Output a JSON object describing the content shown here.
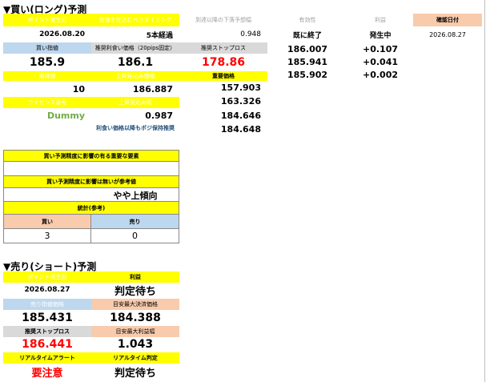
{
  "section1": {
    "title": "▼買い(ロング)予測",
    "hdr": {
      "point_date": "ポイント発生日",
      "timing": "指値を仕込むべきタイミング",
      "deadline": "到達以降の下落予想幅",
      "expiry": "有効性",
      "profit": "利益",
      "decision": "確認日付"
    },
    "row1": {
      "date": "2026.08.20",
      "timing": "5本経過",
      "deadline_val": "0.948",
      "expiry_val": "既に終了",
      "profit_val": "発生中",
      "decision_date": "2026.08.27"
    },
    "hdr2": {
      "buy_limit": "買い指値",
      "recommended": "推奨利食い価格（20pips固定）",
      "stoploss": "推奨ストップロス",
      "important": "重要価格"
    },
    "row2": {
      "buy_limit": "185.9",
      "recommended": "186.1",
      "stoploss": "178.86"
    },
    "hdr3": {
      "period": "期待値",
      "upper": "上昇見込み価格",
      "license": "ライセンス番号",
      "upper2": "上昇見込み幅"
    },
    "row3": {
      "period": "10",
      "upper": "186.887"
    },
    "row4": {
      "license": "Dummy",
      "upper2": "0.987"
    },
    "note": "利食い価格以降もポジ保持推奨",
    "important_prices": [
      "157.903",
      "163.326",
      "184.646",
      "184.648"
    ],
    "extra": [
      {
        "price": "186.007",
        "diff": "+0.107"
      },
      {
        "price": "185.941",
        "diff": "+0.041"
      },
      {
        "price": "185.902",
        "diff": "+0.002"
      }
    ]
  },
  "box2": {
    "hdr1": "買い予測精度に影響の有る重要な要素",
    "hdr2": "買い予測精度に影響は無いが参考値",
    "trend": "やや上傾向",
    "stats_hdr": "統計(参考)",
    "buy_label": "買い",
    "sell_label": "売り",
    "buy_count": "3",
    "sell_count": "0"
  },
  "section2": {
    "title": "▼売り(ショート)予測",
    "hdr1": {
      "point_date": "ポイント発生日",
      "profit": "利益"
    },
    "row1": {
      "date": "2026.08.27",
      "profit": "判定待ち"
    },
    "hdr2": {
      "sell_limit": "売り指値価格",
      "max_price": "目安最大決済価格"
    },
    "row2": {
      "sell_limit": "185.431",
      "max_price": "184.388"
    },
    "hdr3": {
      "stoploss": "推奨ストップロス",
      "max_profit": "目安最大利益幅"
    },
    "row3": {
      "stoploss": "186.441",
      "max_profit": "1.043"
    },
    "hdr4": {
      "alert": "リアルタイムアラート",
      "judge": "リアルタイム判定"
    },
    "row4": {
      "alert": "要注意",
      "judge": "判定待ち"
    }
  }
}
